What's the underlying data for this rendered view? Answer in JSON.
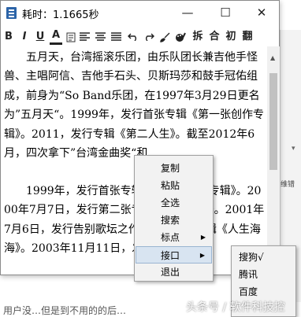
{
  "window": {
    "title": "耗时：1.1665秒",
    "minimize": "—",
    "maximize": "☐",
    "close": "✕"
  },
  "toolbar": {
    "bold": "B",
    "italic": "I",
    "underline": "U",
    "font_color": "A",
    "simplified_to_traditional": "拆",
    "merge": "合",
    "initial": "初",
    "translate": "翻"
  },
  "content": {
    "paragraphs": [
      "五月天，台湾摇滚乐团，由乐队团长兼吉他手怪兽、主唱阿信、吉他手石头、贝斯玛莎和鼓手冠佑组成，前身为“So Band乐团，在1997年3月29日更名为”五月天“。1999年，发行首张专辑《第一张创作专辑》。2011，发行专辑《第二人生》。截至2012年6月，四次拿下”台湾金曲奖“和",
      "1999年，发行首张专辑《第一张创作专辑》。2000年7月7日，发行第二张专辑《爱情万岁》。2001年7月6日，发行告别歌坛之作第三张创作专辑《人生海海》。2003年11月11日，发行第四张专辑"
    ]
  },
  "context_menu": {
    "items": [
      "复制",
      "粘贴",
      "全选",
      "搜索",
      "标点",
      "接口",
      "退出"
    ],
    "arrow": "▶"
  },
  "submenu": {
    "items": [
      "搜狗√",
      "腾讯",
      "百度"
    ]
  },
  "background": {
    "dropdown_arrow": "▾",
    "side_word": "维错",
    "bottom_text": "用户没…但是到不用的的后…"
  },
  "watermark": "头条号 / 软件科技控"
}
